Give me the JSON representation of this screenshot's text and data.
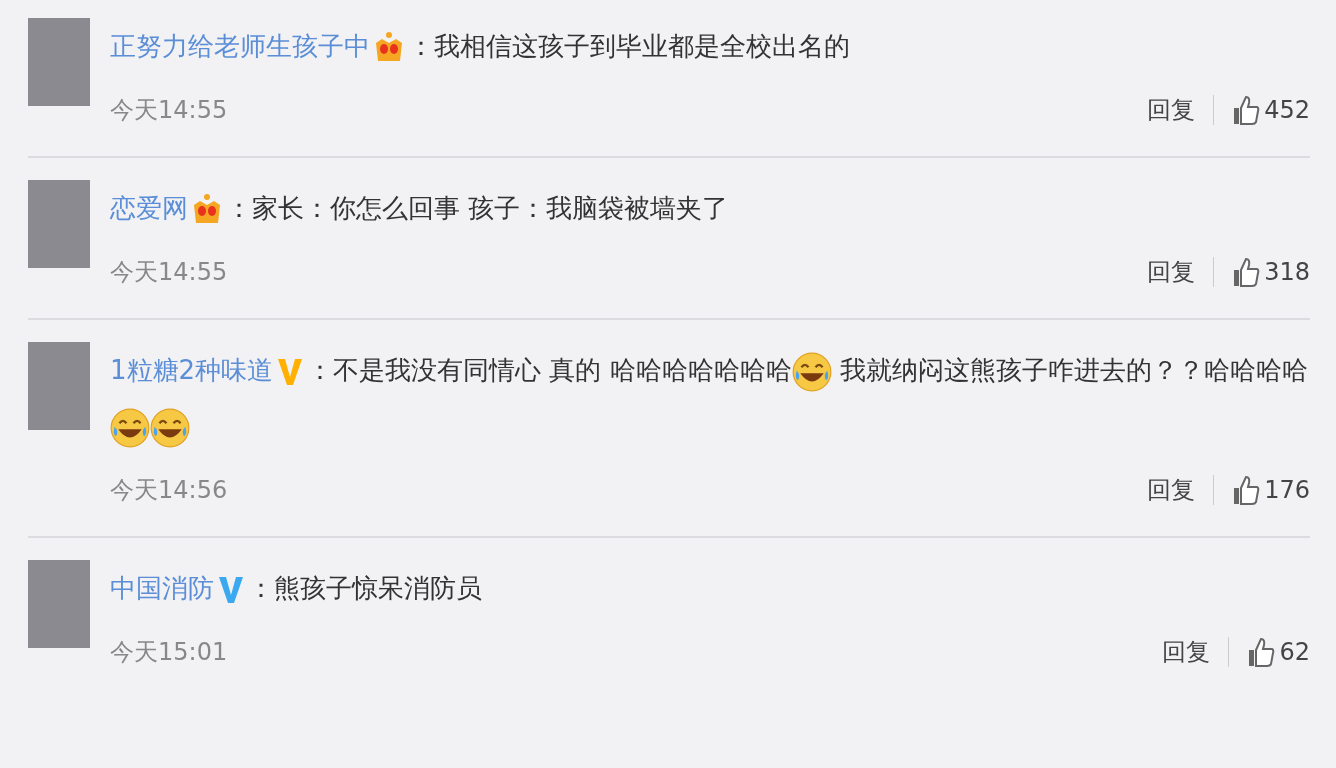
{
  "comments": [
    {
      "user": "正努力给老师生孩子中",
      "badge": {
        "kind": "crown",
        "color": "#f5a623"
      },
      "colon": "：",
      "body": [
        {
          "kind": "text",
          "text": "我相信这孩子到毕业都是全校出名的"
        }
      ],
      "time": "今天14:55",
      "reply": "回复",
      "likes": "452"
    },
    {
      "user": "恋爱网",
      "badge": {
        "kind": "crown",
        "color": "#f5a623"
      },
      "colon": "：",
      "body": [
        {
          "kind": "text",
          "text": "家长：你怎么回事 孩子：我脑袋被墙夹了"
        }
      ],
      "time": "今天14:55",
      "reply": "回复",
      "likes": "318"
    },
    {
      "user": "1粒糖2种味道",
      "badge": {
        "kind": "verified",
        "color": "#ffb000"
      },
      "colon": "：",
      "body": [
        {
          "kind": "text",
          "text": "不是我没有同情心 真的 哈哈哈哈哈哈哈"
        },
        {
          "kind": "emoji"
        },
        {
          "kind": "text",
          "text": " 我就纳闷这熊孩子咋进去的？？哈哈哈哈"
        },
        {
          "kind": "emoji"
        },
        {
          "kind": "emoji"
        }
      ],
      "time": "今天14:56",
      "reply": "回复",
      "likes": "176"
    },
    {
      "user": "中国消防",
      "badge": {
        "kind": "verified",
        "color": "#3ba9f0"
      },
      "colon": "：",
      "body": [
        {
          "kind": "text",
          "text": "熊孩子惊呆消防员"
        }
      ],
      "time": "今天15:01",
      "reply": "回复",
      "likes": "62"
    }
  ]
}
